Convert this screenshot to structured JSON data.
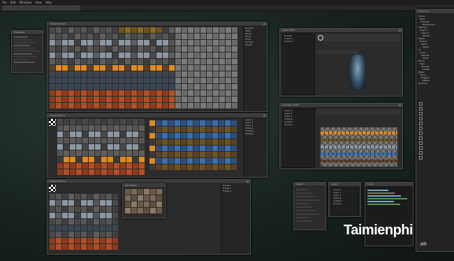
{
  "menubar": {
    "items": [
      "File",
      "Edit",
      "Windows",
      "View",
      "Help"
    ]
  },
  "windows": {
    "tileset_a": {
      "title": "Tileset Window"
    },
    "tileset_b": {
      "title": "Tileset Window"
    },
    "tileset_c": {
      "title": "Tileset Window"
    },
    "properties_left": {
      "title": "Properties"
    },
    "sprite_editor": {
      "title": "Sprite Editor"
    },
    "animation": {
      "title": "Animation Editor"
    },
    "small_a": {
      "title": "Object"
    },
    "small_b": {
      "title": "Layers"
    },
    "code": {
      "title": "Script"
    },
    "hierarchy": {
      "title": "Hierarchy"
    },
    "mini_tiles": {
      "title": "Tile Palette"
    }
  },
  "hierarchy": {
    "items": [
      "Scene",
      "Root",
      "Camera",
      "Background",
      "Tilemap",
      "Layer 1",
      "Layer 2",
      "Sprites",
      "Player",
      "Enemy",
      "Items",
      "Lights",
      "UI",
      "Audio",
      "Objects",
      "Props",
      "Doors",
      "Keys",
      "Torches",
      "Chests",
      "Walls",
      "Floors",
      "Triggers",
      "Effects",
      "Particles"
    ]
  },
  "side_lists": {
    "list_a": [
      "Brushes",
      "Walls",
      "Floors",
      "Doors",
      "Props",
      "Torches",
      "Chests"
    ],
    "list_b": [
      "Layer 1",
      "Layer 2",
      "Layer 3",
      "Shadow",
      "Collision",
      "Overlay"
    ],
    "list_c": [
      "Frames",
      "Frame 1",
      "Frame 2"
    ]
  },
  "colors": {
    "accent": "#3a6fb0",
    "torch": "#e08a20",
    "crate": "#c2532a"
  },
  "watermark": {
    "brand": "Taimienphi",
    "tld": ".vn"
  }
}
